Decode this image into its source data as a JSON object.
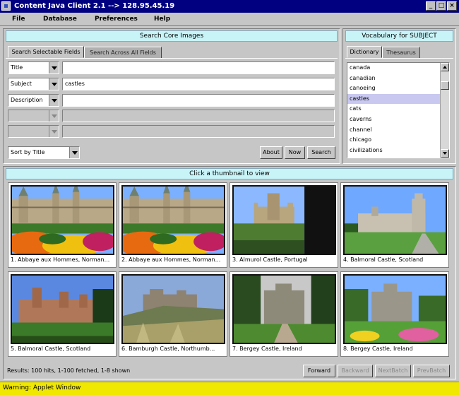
{
  "window": {
    "title": "Content Java Client 2.1 --> 128.95.45.19"
  },
  "menu": [
    "File",
    "Database",
    "Preferences",
    "Help"
  ],
  "search": {
    "header": "Search Core Images",
    "tabs": [
      "Search Selectable Fields",
      "Search Across All Fields"
    ],
    "rows": [
      {
        "field": "Title",
        "value": ""
      },
      {
        "field": "Subject",
        "value": "castles"
      },
      {
        "field": "Description",
        "value": ""
      },
      {
        "field": "",
        "value": ""
      },
      {
        "field": "",
        "value": ""
      }
    ],
    "sort": "Sort by Title",
    "buttons": {
      "about": "About",
      "now": "Now",
      "search": "Search"
    }
  },
  "vocab": {
    "header": "Vocabulary for SUBJECT",
    "tabs": [
      "Dictionary",
      "Thesaurus"
    ],
    "items": [
      "canada",
      "canadian",
      "canoeing",
      "castles",
      "cats",
      "caverns",
      "channel",
      "chicago",
      "civilizations"
    ],
    "selected_index": 3
  },
  "results": {
    "header": "Click a thumbnail to view",
    "thumbnails": [
      {
        "caption": "1.  Abbaye aux Hommes, Norman...",
        "scene": "abbey"
      },
      {
        "caption": "2.  Abbaye aux Hommes, Norman...",
        "scene": "abbey"
      },
      {
        "caption": "3.  Almurol Castle, Portugal",
        "scene": "almourol"
      },
      {
        "caption": "4.  Balmoral Castle, Scotland",
        "scene": "balmoral_lawn"
      },
      {
        "caption": "5.  Balmoral Castle, Scotland",
        "scene": "balmoral_red"
      },
      {
        "caption": "6.  Bamburgh Castle, Northumb...",
        "scene": "bamburgh"
      },
      {
        "caption": "7.  Bergey Castle, Ireland",
        "scene": "ireland"
      },
      {
        "caption": "8.  Bergey Castle, Ireland",
        "scene": "ireland_flowers"
      }
    ],
    "status": "Results: 100 hits, 1-100 fetched, 1-8 shown",
    "nav": {
      "forward": "Forward",
      "backward": "Backward",
      "next_batch": "NextBatch",
      "prev_batch": "PrevBatch"
    }
  },
  "warning": "Warning: Applet Window"
}
